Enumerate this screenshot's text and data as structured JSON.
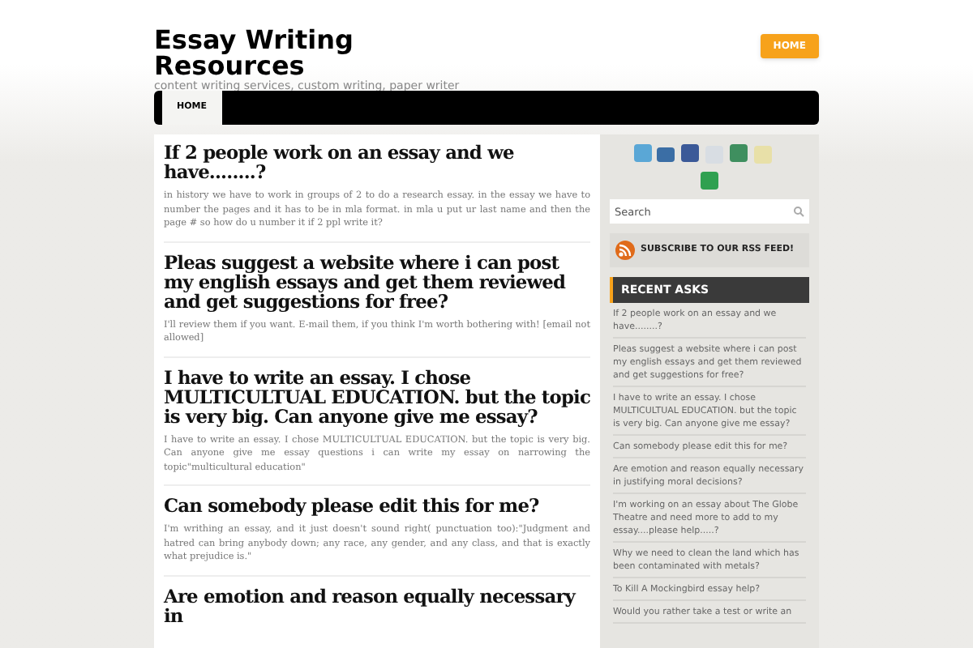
{
  "site": {
    "title": "Essay Writing Resources",
    "tagline": "content writing services, custom writing, paper writer",
    "top_button": "HOME"
  },
  "nav": [
    {
      "label": "HOME",
      "selected": true
    }
  ],
  "posts": [
    {
      "title": "If 2 people work on an essay and we have........?",
      "excerpt": "in history we have to work in groups of 2 to do a research essay. in the essay we have to number the pages and it has to be in mla format. in mla u put ur last name and then the page # so how do u number it if 2 ppl write it?"
    },
    {
      "title": "Pleas suggest a website where i can post my english essays and get them reviewed and get suggestions for free?",
      "excerpt": "I'll review them if you want. E-mail them, if you think I'm worth bothering with! [email not allowed]"
    },
    {
      "title": "I have to write an essay. I chose MULTICULTUAL EDUCATION. but the topic is very big. Can anyone give me essay?",
      "excerpt": "I have to write an essay. I chose MULTICULTUAL EDUCATION. but the topic is very big. Can anyone give me essay questions i can write my essay on narrowing the topic\"multicultural education\""
    },
    {
      "title": "Can somebody please edit this for me?",
      "excerpt": "I'm writhing an essay, and it just doesn't sound right( punctuation too):\"Judgment and hatred can bring anybody down; any race, any gender, and any class, and that is exactly what prejudice is.\""
    },
    {
      "title": "Are emotion and reason equally necessary in"
    }
  ],
  "sidebar": {
    "search": {
      "placeholder": "Search"
    },
    "rss": "SUBSCRIBE TO OUR RSS FEED!",
    "recent_heading": "RECENT ASKS",
    "recent": [
      "If 2 people work on an essay and we have........?",
      "Pleas suggest a website where i can post my english essays and get them reviewed and get suggestions for free?",
      "I have to write an essay. I chose MULTICULTUAL EDUCATION. but the topic is very big. Can anyone give me essay?",
      "Can somebody please edit this for me?",
      "Are emotion and reason equally necessary in justifying moral decisions?",
      "I'm working on an essay about The Globe Theatre and need more to add to my essay....please help.....?",
      "Why we need to clean the land which has been contaminated with metals?",
      "To Kill A Mockingbird essay help?",
      "Would you rather take a test or write an"
    ]
  }
}
